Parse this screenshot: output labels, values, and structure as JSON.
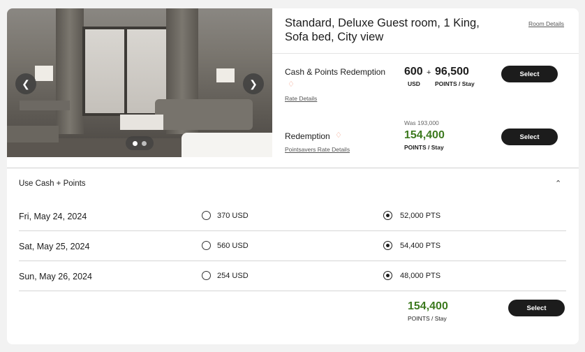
{
  "room": {
    "title": "Standard, Deluxe Guest room, 1 King, Sofa bed, City view",
    "details_link": "Room Details"
  },
  "gallery": {
    "prev_icon": "chevron-left-icon",
    "next_icon": "chevron-right-icon",
    "dots": 2,
    "active_dot": 0
  },
  "rates": [
    {
      "name": "Cash & Points Redemption",
      "link": "Rate Details",
      "cash_amount": "600",
      "plus": "+",
      "points_amount": "96,500",
      "cash_unit": "USD",
      "points_unit": "POINTS / Stay",
      "button": "Select"
    },
    {
      "name": "Redemption",
      "link": "Pointsavers Rate Details",
      "was": "Was 193,000",
      "points_amount": "154,400",
      "points_unit": "POINTS / Stay",
      "button": "Select"
    }
  ],
  "cash_points": {
    "title": "Use Cash + Points",
    "rows": [
      {
        "date": "Fri, May 24, 2024",
        "cash": "370 USD",
        "points": "52,000 PTS"
      },
      {
        "date": "Sat, May 25, 2024",
        "cash": "560 USD",
        "points": "54,400 PTS"
      },
      {
        "date": "Sun, May 26, 2024",
        "cash": "254 USD",
        "points": "48,000 PTS"
      }
    ],
    "total_points": "154,400",
    "total_unit": "POINTS / Stay",
    "button": "Select"
  },
  "colors": {
    "accent_green": "#3d7a1f",
    "button_bg": "#1c1c1c",
    "tag_icon": "#f08a6c"
  }
}
